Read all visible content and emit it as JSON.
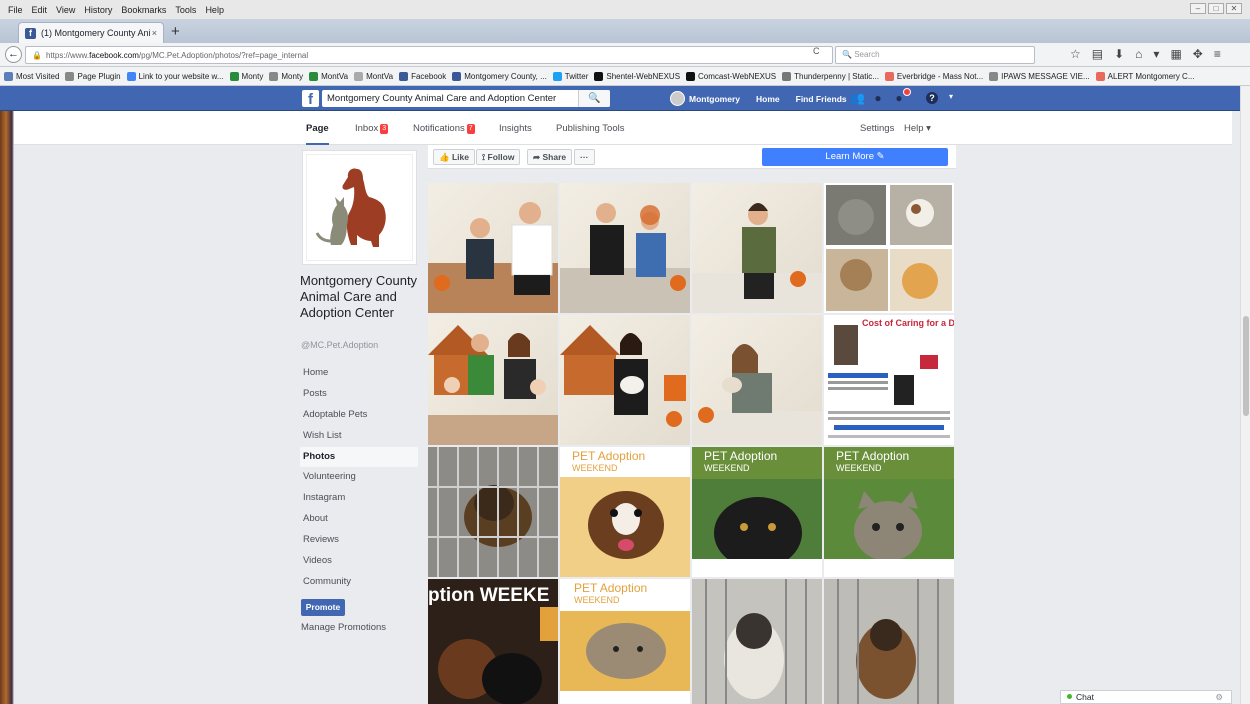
{
  "menubar": {
    "items": [
      "File",
      "Edit",
      "View",
      "History",
      "Bookmarks",
      "Tools",
      "Help"
    ]
  },
  "tab": {
    "title": "(1) Montgomery County Ani",
    "close": "×",
    "new": "+"
  },
  "navbar": {
    "url_prefix": "https://www.",
    "url_host": "facebook.com",
    "url_path": "/pg/MC.Pet.Adoption/photos/?ref=page_internal",
    "search_placeholder": "Search"
  },
  "bookmarks": [
    {
      "label": "Most Visited",
      "color": "#5b7fb8"
    },
    {
      "label": "Page Plugin",
      "color": "#888888"
    },
    {
      "label": "Link to your website w...",
      "color": "#4285f4"
    },
    {
      "label": "Monty",
      "color": "#2a8b3c"
    },
    {
      "label": "Monty",
      "color": "#888888"
    },
    {
      "label": "MontVa",
      "color": "#2a8b3c"
    },
    {
      "label": "MontVa",
      "color": "#aaaaaa"
    },
    {
      "label": "Facebook",
      "color": "#3b5998"
    },
    {
      "label": "Montgomery County, ...",
      "color": "#3b5998"
    },
    {
      "label": "Twitter",
      "color": "#1da1f2"
    },
    {
      "label": "Shentel-WebNEXUS",
      "color": "#111111"
    },
    {
      "label": "Comcast-WebNEXUS",
      "color": "#111111"
    },
    {
      "label": "Thunderpenny | Static...",
      "color": "#777777"
    },
    {
      "label": "Everbridge - Mass Not...",
      "color": "#e86a5a"
    },
    {
      "label": "IPAWS MESSAGE VIE...",
      "color": "#888888"
    },
    {
      "label": "ALERT Montgomery C...",
      "color": "#e86a5a"
    }
  ],
  "fb": {
    "search_value": "Montgomery County Animal Care and Adoption Center",
    "user": "Montgomery",
    "home": "Home",
    "find_friends": "Find Friends"
  },
  "pagenav": {
    "page": "Page",
    "inbox": "Inbox",
    "inbox_count": "3",
    "notifications": "Notifications",
    "notifications_count": "7",
    "insights": "Insights",
    "publishing": "Publishing Tools",
    "settings": "Settings",
    "help": "Help ▾"
  },
  "page": {
    "name": "Montgomery County Animal Care and Adoption Center",
    "handle": "@MC.Pet.Adoption"
  },
  "leftnav": [
    "Home",
    "Posts",
    "Adoptable Pets",
    "Wish List",
    "Photos",
    "Volunteering",
    "Instagram",
    "About",
    "Reviews",
    "Videos",
    "Community"
  ],
  "leftnav_active": 4,
  "promote": "Promote",
  "manage_promotions": "Manage Promotions",
  "actions": {
    "like": "Like",
    "follow": "Follow",
    "share": "Share",
    "more": "···",
    "learn_more": "Learn More ✎"
  },
  "posters": {
    "pet": "PET Adoption",
    "weekend": "WEEKEND",
    "caring_title": "Cost of Caring for a Dog",
    "big_banner": "ption WEEKE"
  },
  "chat": "Chat"
}
